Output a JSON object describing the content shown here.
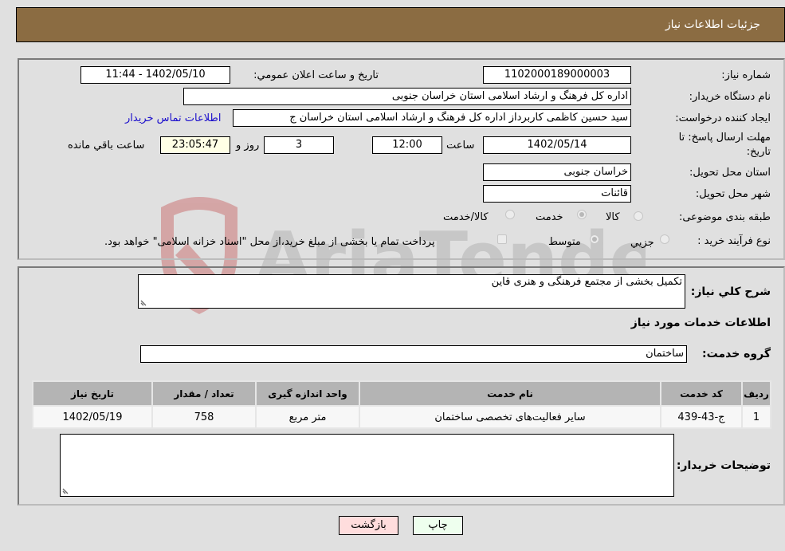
{
  "header": {
    "title": "جزئیات اطلاعات نیاز"
  },
  "details": {
    "need_number": {
      "label": "شماره نیاز:",
      "value": "1102000189000003"
    },
    "announce_datetime": {
      "label": "تاریخ و ساعت اعلان عمومي:",
      "value": "1402/05/10 - 11:44"
    },
    "buyer_org": {
      "label": "نام دستگاه خریدار:",
      "value": "اداره کل فرهنگ و ارشاد اسلامی استان خراسان جنوبی"
    },
    "requester": {
      "label": "ایجاد کننده درخواست:",
      "value": "سید حسین کاظمی کاربرداز اداره کل فرهنگ و ارشاد اسلامی استان خراسان ج",
      "contact_link": "اطلاعات تماس خریدار"
    },
    "deadline": {
      "label_line1": "مهلت ارسال پاسخ: تا",
      "label_line2": "تاریخ:",
      "date": "1402/05/14",
      "time_label": "ساعت",
      "time": "12:00",
      "days": "3",
      "days_label": "روز و",
      "remaining": "23:05:47",
      "remaining_label": "ساعت باقي مانده"
    },
    "delivery_province": {
      "label": "استان محل تحویل:",
      "value": "خراسان جنوبی"
    },
    "delivery_city": {
      "label": "شهر محل تحویل:",
      "value": "قائنات"
    },
    "category": {
      "label": "طبقه بندی موضوعی:",
      "options": [
        {
          "label": "کالا",
          "checked": false
        },
        {
          "label": "خدمت",
          "checked": true
        },
        {
          "label": "کالا/خدمت",
          "checked": false
        }
      ]
    },
    "purchase_type": {
      "label": "نوع فرآیند خرید :",
      "options": [
        {
          "label": "جزيي",
          "checked": false
        },
        {
          "label": "متوسط",
          "checked": true
        }
      ],
      "treasury_note": "پرداخت تمام یا بخشی از مبلغ خرید،از محل \"اسناد خزانه اسلامی\" خواهد بود.",
      "treasury_checked": false
    }
  },
  "summary": {
    "description_label": "شرح کلي نياز:",
    "description": "تکمیل بخشی از مجتمع فرهنگی و هنری قاین",
    "services_heading": "اطلاعات خدمات مورد نياز",
    "service_group_label": "گروه خدمت:",
    "service_group": "ساختمان"
  },
  "table": {
    "headers": [
      "ردیف",
      "کد خدمت",
      "نام خدمت",
      "واحد اندازه گیری",
      "تعداد / مقدار",
      "تاریخ نیاز"
    ],
    "rows": [
      [
        "1",
        "ج-43-439",
        "سایر فعالیت‌های تخصصی ساختمان",
        "متر مربع",
        "758",
        "1402/05/19"
      ]
    ]
  },
  "buyer_notes": {
    "label": "توضيحات خريدار:",
    "value": ""
  },
  "buttons": {
    "print": "چاپ",
    "back": "بازگشت"
  },
  "watermark": {
    "text": "AriaTender.neT"
  }
}
